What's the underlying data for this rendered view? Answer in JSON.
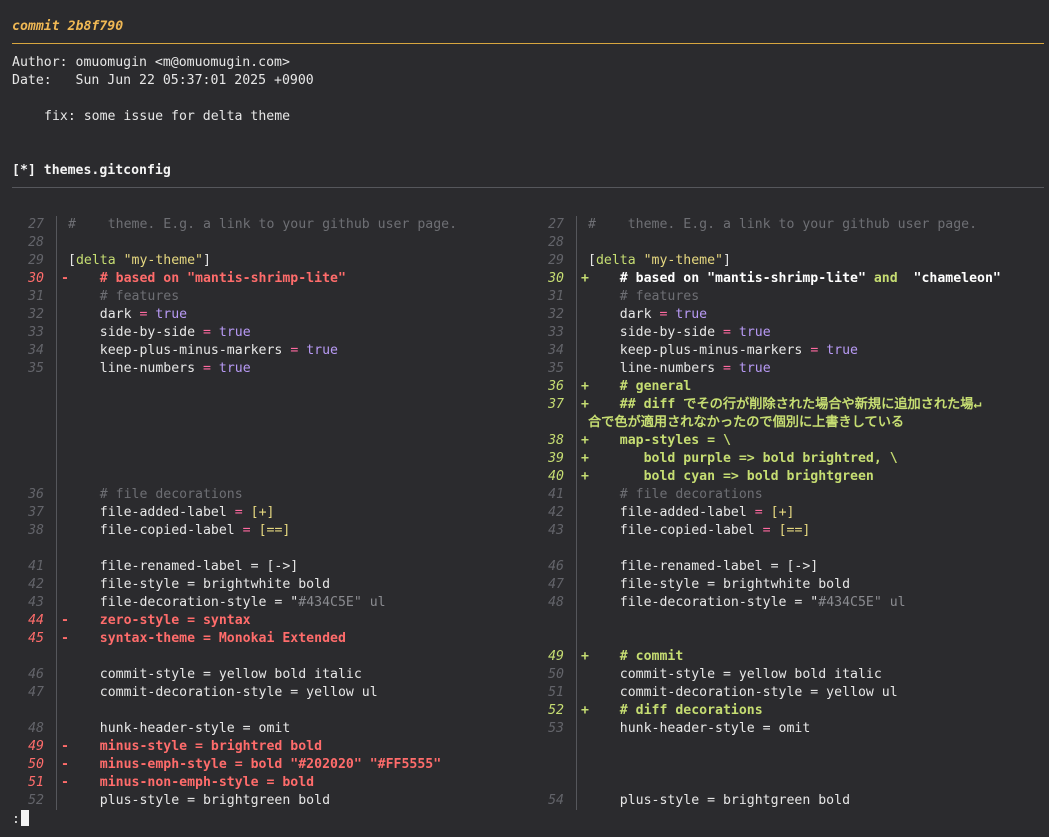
{
  "header": {
    "commit": "commit 2b8f790",
    "author": "Author: omuomugin <m@omuomugin.com>",
    "date": "Date:   Sun Jun 22 05:37:01 2025 +0900",
    "message": "fix: some issue for delta theme",
    "file": "[*] themes.gitconfig",
    "colors": {
      "commit": "#f0b854",
      "deleted": "#ff6c6b",
      "added": "#c6dd72",
      "background": "#2b2b2e"
    }
  },
  "left": [
    {
      "n": "27",
      "t": "ctx",
      "parts": [
        {
          "c": "cmt",
          "v": "#    theme. E.g. a link to your github user page."
        }
      ]
    },
    {
      "n": "28",
      "t": "ctx",
      "parts": []
    },
    {
      "n": "29",
      "t": "ctx",
      "parts": [
        {
          "c": "",
          "v": "["
        },
        {
          "c": "sec",
          "v": "delta "
        },
        {
          "c": "str",
          "v": "\"my-theme\""
        },
        {
          "c": "",
          "v": "]"
        }
      ]
    },
    {
      "n": "30",
      "t": "del",
      "m": "-",
      "parts": [
        {
          "c": "",
          "v": "    # based on \"mantis-shrimp-lite\""
        }
      ]
    },
    {
      "n": "31",
      "t": "ctx",
      "parts": [
        {
          "c": "cmt",
          "v": "    # features"
        }
      ]
    },
    {
      "n": "32",
      "t": "ctx",
      "parts": [
        {
          "c": "",
          "v": "    dark "
        },
        {
          "c": "op",
          "v": "="
        },
        {
          "c": "val",
          "v": " true"
        }
      ]
    },
    {
      "n": "33",
      "t": "ctx",
      "parts": [
        {
          "c": "",
          "v": "    side-by-side "
        },
        {
          "c": "op",
          "v": "="
        },
        {
          "c": "val",
          "v": " true"
        }
      ]
    },
    {
      "n": "34",
      "t": "ctx",
      "parts": [
        {
          "c": "",
          "v": "    keep-plus-minus-markers "
        },
        {
          "c": "op",
          "v": "="
        },
        {
          "c": "val",
          "v": " true"
        }
      ]
    },
    {
      "n": "35",
      "t": "ctx",
      "parts": [
        {
          "c": "",
          "v": "    line-numbers "
        },
        {
          "c": "op",
          "v": "="
        },
        {
          "c": "val",
          "v": " true"
        }
      ]
    },
    {
      "n": "",
      "t": "blank",
      "parts": []
    },
    {
      "n": "",
      "t": "blank",
      "parts": []
    },
    {
      "n": "",
      "t": "blank",
      "parts": []
    },
    {
      "n": "",
      "t": "blank",
      "parts": []
    },
    {
      "n": "",
      "t": "blank",
      "parts": []
    },
    {
      "n": "",
      "t": "blank",
      "parts": []
    },
    {
      "n": "36",
      "t": "ctx",
      "parts": [
        {
          "c": "cmt",
          "v": "    # file decorations"
        }
      ]
    },
    {
      "n": "37",
      "t": "ctx",
      "parts": [
        {
          "c": "",
          "v": "    file-added-label "
        },
        {
          "c": "op",
          "v": "="
        },
        {
          "c": "str",
          "v": " [+]"
        }
      ]
    },
    {
      "n": "38",
      "t": "ctx",
      "parts": [
        {
          "c": "",
          "v": "    file-copied-label "
        },
        {
          "c": "op",
          "v": "="
        },
        {
          "c": "str",
          "v": " [==]"
        }
      ]
    },
    {
      "n": "",
      "t": "gap",
      "parts": []
    },
    {
      "n": "41",
      "t": "ctx",
      "parts": [
        {
          "c": "",
          "v": "    file-renamed-label = [->]"
        }
      ]
    },
    {
      "n": "42",
      "t": "ctx",
      "parts": [
        {
          "c": "",
          "v": "    file-style = brightwhite bold"
        }
      ]
    },
    {
      "n": "43",
      "t": "ctx",
      "parts": [
        {
          "c": "",
          "v": "    file-decoration-style = \""
        },
        {
          "c": "hex",
          "v": "#434C5E\" ul"
        }
      ]
    },
    {
      "n": "44",
      "t": "del",
      "m": "-",
      "parts": [
        {
          "c": "",
          "v": "    zero-style = syntax"
        }
      ]
    },
    {
      "n": "45",
      "t": "del",
      "m": "-",
      "parts": [
        {
          "c": "",
          "v": "    syntax-theme = Monokai Extended"
        }
      ]
    },
    {
      "n": "",
      "t": "blank",
      "parts": []
    },
    {
      "n": "46",
      "t": "ctx",
      "parts": [
        {
          "c": "",
          "v": "    commit-style = yellow bold italic"
        }
      ]
    },
    {
      "n": "47",
      "t": "ctx",
      "parts": [
        {
          "c": "",
          "v": "    commit-decoration-style = yellow ul"
        }
      ]
    },
    {
      "n": "",
      "t": "blank",
      "parts": []
    },
    {
      "n": "48",
      "t": "ctx",
      "parts": [
        {
          "c": "",
          "v": "    hunk-header-style = omit"
        }
      ]
    },
    {
      "n": "49",
      "t": "del",
      "m": "-",
      "parts": [
        {
          "c": "",
          "v": "    minus-style = brightred bold"
        }
      ]
    },
    {
      "n": "50",
      "t": "del",
      "m": "-",
      "parts": [
        {
          "c": "",
          "v": "    minus-emph-style = bold \"#202020\" \"#FF5555\""
        }
      ]
    },
    {
      "n": "51",
      "t": "del",
      "m": "-",
      "parts": [
        {
          "c": "",
          "v": "    minus-non-emph-style = bold"
        }
      ]
    },
    {
      "n": "52",
      "t": "ctx",
      "parts": [
        {
          "c": "",
          "v": "    plus-style = brightgreen bold"
        }
      ]
    }
  ],
  "right": [
    {
      "n": "27",
      "t": "ctx",
      "parts": [
        {
          "c": "cmt",
          "v": "#    theme. E.g. a link to your github user page."
        }
      ]
    },
    {
      "n": "28",
      "t": "ctx",
      "parts": []
    },
    {
      "n": "29",
      "t": "ctx",
      "parts": [
        {
          "c": "",
          "v": "["
        },
        {
          "c": "sec",
          "v": "delta "
        },
        {
          "c": "str",
          "v": "\"my-theme\""
        },
        {
          "c": "",
          "v": "]"
        }
      ]
    },
    {
      "n": "30",
      "t": "add",
      "m": "+",
      "parts": [
        {
          "c": "w",
          "v": "    # based on \"mantis-shrimp-lite\""
        },
        {
          "c": "",
          "v": " and "
        },
        {
          "c": "w",
          "v": " \"chameleon\""
        }
      ]
    },
    {
      "n": "31",
      "t": "ctx",
      "parts": [
        {
          "c": "cmt",
          "v": "    # features"
        }
      ]
    },
    {
      "n": "32",
      "t": "ctx",
      "parts": [
        {
          "c": "",
          "v": "    dark "
        },
        {
          "c": "op",
          "v": "="
        },
        {
          "c": "val",
          "v": " true"
        }
      ]
    },
    {
      "n": "33",
      "t": "ctx",
      "parts": [
        {
          "c": "",
          "v": "    side-by-side "
        },
        {
          "c": "op",
          "v": "="
        },
        {
          "c": "val",
          "v": " true"
        }
      ]
    },
    {
      "n": "34",
      "t": "ctx",
      "parts": [
        {
          "c": "",
          "v": "    keep-plus-minus-markers "
        },
        {
          "c": "op",
          "v": "="
        },
        {
          "c": "val",
          "v": " true"
        }
      ]
    },
    {
      "n": "35",
      "t": "ctx",
      "parts": [
        {
          "c": "",
          "v": "    line-numbers "
        },
        {
          "c": "op",
          "v": "="
        },
        {
          "c": "val",
          "v": " true"
        }
      ]
    },
    {
      "n": "36",
      "t": "add",
      "m": "+",
      "parts": [
        {
          "c": "",
          "v": "    # general"
        }
      ]
    },
    {
      "n": "37",
      "t": "add",
      "m": "+",
      "parts": [
        {
          "c": "",
          "v": "    ## diff でその行が削除された場合や新規に追加された場↵"
        }
      ]
    },
    {
      "n": "",
      "t": "wrap",
      "parts": [
        {
          "c": "",
          "v": "合で色が適用されなかったので個別に上書きしている"
        }
      ]
    },
    {
      "n": "38",
      "t": "add",
      "m": "+",
      "parts": [
        {
          "c": "",
          "v": "    map-styles = \\"
        }
      ]
    },
    {
      "n": "39",
      "t": "add",
      "m": "+",
      "parts": [
        {
          "c": "",
          "v": "       bold purple => bold brightred, \\"
        }
      ]
    },
    {
      "n": "40",
      "t": "add",
      "m": "+",
      "parts": [
        {
          "c": "",
          "v": "       bold cyan => bold brightgreen"
        }
      ]
    },
    {
      "n": "41",
      "t": "ctx",
      "parts": [
        {
          "c": "cmt",
          "v": "    # file decorations"
        }
      ]
    },
    {
      "n": "42",
      "t": "ctx",
      "parts": [
        {
          "c": "",
          "v": "    file-added-label "
        },
        {
          "c": "op",
          "v": "="
        },
        {
          "c": "str",
          "v": " [+]"
        }
      ]
    },
    {
      "n": "43",
      "t": "ctx",
      "parts": [
        {
          "c": "",
          "v": "    file-copied-label "
        },
        {
          "c": "op",
          "v": "="
        },
        {
          "c": "str",
          "v": " [==]"
        }
      ]
    },
    {
      "n": "",
      "t": "gap",
      "parts": []
    },
    {
      "n": "46",
      "t": "ctx",
      "parts": [
        {
          "c": "",
          "v": "    file-renamed-label = [->]"
        }
      ]
    },
    {
      "n": "47",
      "t": "ctx",
      "parts": [
        {
          "c": "",
          "v": "    file-style = brightwhite bold"
        }
      ]
    },
    {
      "n": "48",
      "t": "ctx",
      "parts": [
        {
          "c": "",
          "v": "    file-decoration-style = \""
        },
        {
          "c": "hex",
          "v": "#434C5E\" ul"
        }
      ]
    },
    {
      "n": "",
      "t": "blank",
      "parts": []
    },
    {
      "n": "",
      "t": "blank",
      "parts": []
    },
    {
      "n": "49",
      "t": "add",
      "m": "+",
      "parts": [
        {
          "c": "",
          "v": "    # commit"
        }
      ]
    },
    {
      "n": "50",
      "t": "ctx",
      "parts": [
        {
          "c": "",
          "v": "    commit-style = yellow bold italic"
        }
      ]
    },
    {
      "n": "51",
      "t": "ctx",
      "parts": [
        {
          "c": "",
          "v": "    commit-decoration-style = yellow ul"
        }
      ]
    },
    {
      "n": "52",
      "t": "add",
      "m": "+",
      "parts": [
        {
          "c": "",
          "v": "    # diff decorations"
        }
      ]
    },
    {
      "n": "53",
      "t": "ctx",
      "parts": [
        {
          "c": "",
          "v": "    hunk-header-style = omit"
        }
      ]
    },
    {
      "n": "",
      "t": "blank",
      "parts": []
    },
    {
      "n": "",
      "t": "blank",
      "parts": []
    },
    {
      "n": "",
      "t": "blank",
      "parts": []
    },
    {
      "n": "54",
      "t": "ctx",
      "parts": [
        {
          "c": "",
          "v": "    plus-style = brightgreen bold"
        }
      ]
    }
  ],
  "prompt": ":"
}
